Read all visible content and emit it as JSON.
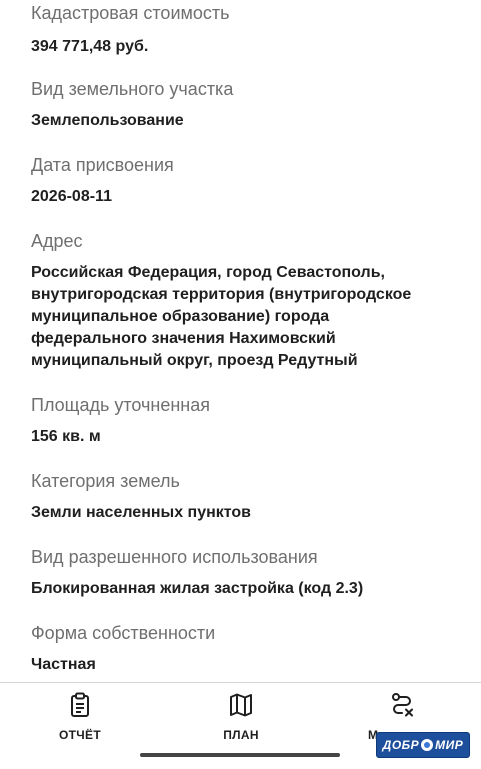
{
  "fields": [
    {
      "label": "Кадастровая стоимость",
      "value": "394 771,48 руб."
    },
    {
      "label": "Вид земельного участка",
      "value": "Землепользование"
    },
    {
      "label": "Дата присвоения",
      "value": "2026-08-11"
    },
    {
      "label": "Адрес",
      "value_lines": [
        "Российская Федерация, город Севастополь,",
        "внутригородская территория (внутригородское",
        "муниципальное образование) города",
        "федерального значения Нахимовский",
        "муниципальный округ, проезд Редутный"
      ]
    },
    {
      "label": "Площадь уточненная",
      "value": "156 кв. м"
    },
    {
      "label": "Категория земель",
      "value": "Земли населенных пунктов"
    },
    {
      "label": "Вид разрешенного использования",
      "value": "Блокированная жилая застройка (код 2.3)"
    },
    {
      "label": "Форма собственности",
      "value": "Частная"
    }
  ],
  "nav": {
    "report": {
      "label": "ОТЧЁТ",
      "icon": "clipboard-icon"
    },
    "plan": {
      "label": "ПЛАН",
      "icon": "map-icon"
    },
    "route": {
      "label": "М",
      "icon": "route-icon"
    }
  },
  "watermark": {
    "left": "ДОБР",
    "right": "МИР"
  }
}
